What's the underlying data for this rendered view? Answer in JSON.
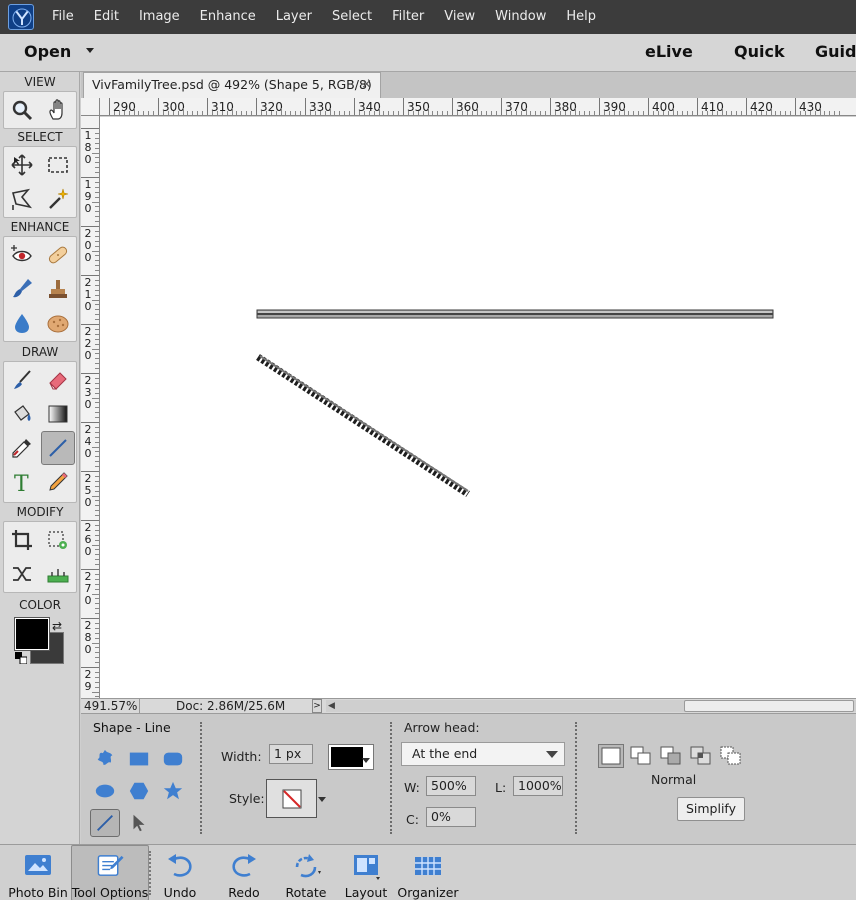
{
  "menu": {
    "items": [
      "File",
      "Edit",
      "Image",
      "Enhance",
      "Layer",
      "Select",
      "Filter",
      "View",
      "Window",
      "Help"
    ]
  },
  "mode_bar": {
    "open_label": "Open",
    "modes": [
      "eLive",
      "Quick",
      "Guided"
    ]
  },
  "toolbox": {
    "sections": {
      "view": "VIEW",
      "select": "SELECT",
      "enhance": "ENHANCE",
      "draw": "DRAW",
      "modify": "MODIFY",
      "color": "COLOR"
    },
    "foreground_color": "#000000",
    "background_color": "#3a3a3a"
  },
  "document": {
    "tab_title": "VivFamilyTree.psd @ 492% (Shape 5, RGB/8) *",
    "close_glyph": "×"
  },
  "rulers": {
    "horizontal": [
      "290",
      "300",
      "310",
      "320",
      "330",
      "340",
      "350",
      "360",
      "370",
      "380",
      "390",
      "400",
      "410",
      "420",
      "430"
    ],
    "vertical": [
      "180",
      "190",
      "200",
      "210",
      "220",
      "230",
      "240",
      "250",
      "260",
      "270",
      "280",
      "29"
    ]
  },
  "status": {
    "zoom": "491.57%",
    "doc_size": "Doc: 2.86M/25.6M"
  },
  "tool_options": {
    "title": "Shape - Line",
    "width_label": "Width:",
    "width_value": "1 px",
    "style_label": "Style:",
    "color_value": "#000000",
    "arrow_head_label": "Arrow head:",
    "arrow_head_value": "At the end",
    "w_label": "W:",
    "w_value": "500%",
    "l_label": "L:",
    "l_value": "1000%",
    "c_label": "C:",
    "c_value": "0%",
    "mode_label": "Normal",
    "simplify_label": "Simplify"
  },
  "bottom_bar": {
    "items": [
      "Photo Bin",
      "Tool Options",
      "Undo",
      "Redo",
      "Rotate",
      "Layout",
      "Organizer"
    ]
  }
}
